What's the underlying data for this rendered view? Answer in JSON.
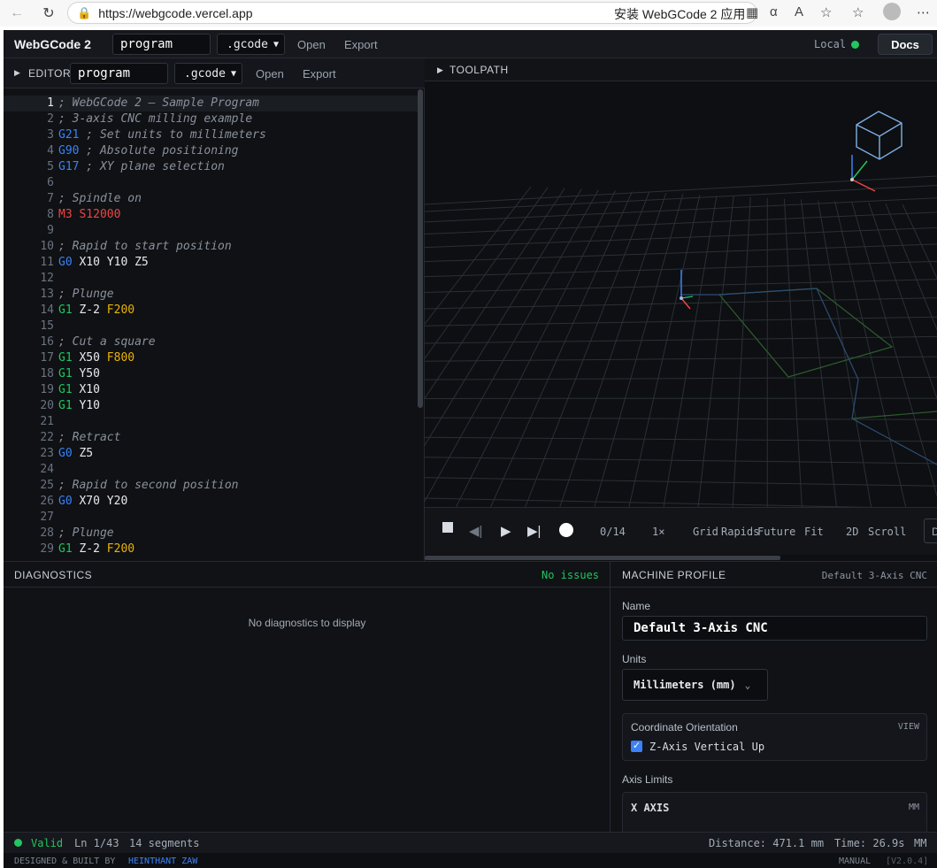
{
  "browser": {
    "url": "https://webgcode.vercel.app",
    "install_text": "安装 WebGCode 2 应用"
  },
  "topbar": {
    "brand": "WebGCode 2",
    "program_name": "program",
    "extension": ".gcode",
    "open_label": "Open",
    "export_label": "Export",
    "local_label": "Local",
    "docs_label": "Docs"
  },
  "editor": {
    "title": "EDITOR",
    "program_name": "program",
    "extension": ".gcode",
    "open_label": "Open",
    "export_label": "Export",
    "lines": [
      {
        "n": "1",
        "tokens": [
          {
            "t": "; WebGCode 2 — Sample Program",
            "c": "comment"
          }
        ]
      },
      {
        "n": "2",
        "tokens": [
          {
            "t": "; 3-axis CNC milling example",
            "c": "comment"
          }
        ]
      },
      {
        "n": "3",
        "tokens": [
          {
            "t": "G21",
            "c": "gset"
          },
          {
            "t": " ; Set units to millimeters",
            "c": "comment"
          }
        ]
      },
      {
        "n": "4",
        "tokens": [
          {
            "t": "G90",
            "c": "gset"
          },
          {
            "t": " ; Absolute positioning",
            "c": "comment"
          }
        ]
      },
      {
        "n": "5",
        "tokens": [
          {
            "t": "G17",
            "c": "gset"
          },
          {
            "t": " ; XY plane selection",
            "c": "comment"
          }
        ]
      },
      {
        "n": "6",
        "tokens": []
      },
      {
        "n": "7",
        "tokens": [
          {
            "t": "; Spindle on",
            "c": "comment"
          }
        ]
      },
      {
        "n": "8",
        "tokens": [
          {
            "t": "M3",
            "c": "m"
          },
          {
            "t": " ",
            "c": "coord"
          },
          {
            "t": "S12000",
            "c": "s"
          }
        ]
      },
      {
        "n": "9",
        "tokens": []
      },
      {
        "n": "10",
        "tokens": [
          {
            "t": "; Rapid to start position",
            "c": "comment"
          }
        ]
      },
      {
        "n": "11",
        "tokens": [
          {
            "t": "G0",
            "c": "gset"
          },
          {
            "t": " X10 Y10 Z5",
            "c": "coord"
          }
        ]
      },
      {
        "n": "12",
        "tokens": []
      },
      {
        "n": "13",
        "tokens": [
          {
            "t": "; Plunge",
            "c": "comment"
          }
        ]
      },
      {
        "n": "14",
        "tokens": [
          {
            "t": "G1",
            "c": "gmove"
          },
          {
            "t": " Z-2 ",
            "c": "coord"
          },
          {
            "t": "F200",
            "c": "f"
          }
        ]
      },
      {
        "n": "15",
        "tokens": []
      },
      {
        "n": "16",
        "tokens": [
          {
            "t": "; Cut a square",
            "c": "comment"
          }
        ]
      },
      {
        "n": "17",
        "tokens": [
          {
            "t": "G1",
            "c": "gmove"
          },
          {
            "t": " X50 ",
            "c": "coord"
          },
          {
            "t": "F800",
            "c": "f"
          }
        ]
      },
      {
        "n": "18",
        "tokens": [
          {
            "t": "G1",
            "c": "gmove"
          },
          {
            "t": " Y50",
            "c": "coord"
          }
        ]
      },
      {
        "n": "19",
        "tokens": [
          {
            "t": "G1",
            "c": "gmove"
          },
          {
            "t": " X10",
            "c": "coord"
          }
        ]
      },
      {
        "n": "20",
        "tokens": [
          {
            "t": "G1",
            "c": "gmove"
          },
          {
            "t": " Y10",
            "c": "coord"
          }
        ]
      },
      {
        "n": "21",
        "tokens": []
      },
      {
        "n": "22",
        "tokens": [
          {
            "t": "; Retract",
            "c": "comment"
          }
        ]
      },
      {
        "n": "23",
        "tokens": [
          {
            "t": "G0",
            "c": "gset"
          },
          {
            "t": " Z5",
            "c": "coord"
          }
        ]
      },
      {
        "n": "24",
        "tokens": []
      },
      {
        "n": "25",
        "tokens": [
          {
            "t": "; Rapid to second position",
            "c": "comment"
          }
        ]
      },
      {
        "n": "26",
        "tokens": [
          {
            "t": "G0",
            "c": "gset"
          },
          {
            "t": " X70 Y20",
            "c": "coord"
          }
        ]
      },
      {
        "n": "27",
        "tokens": []
      },
      {
        "n": "28",
        "tokens": [
          {
            "t": "; Plunge",
            "c": "comment"
          }
        ]
      },
      {
        "n": "29",
        "tokens": [
          {
            "t": "G1",
            "c": "gmove"
          },
          {
            "t": " Z-2 ",
            "c": "coord"
          },
          {
            "t": "F200",
            "c": "f"
          }
        ]
      }
    ]
  },
  "toolpath": {
    "title": "TOOLPATH",
    "progress": "0/14",
    "speed": "1×",
    "grid_label": "Grid",
    "rapids_label": "Rapids",
    "future_label": "Future",
    "fit_label": "Fit",
    "view_2d_label": "2D",
    "scroll_label": "Scroll",
    "extra_label": "D"
  },
  "diagnostics": {
    "title": "DIAGNOSTICS",
    "status": "No issues",
    "empty_text": "No diagnostics to display"
  },
  "machine": {
    "title": "MACHINE PROFILE",
    "profile_name": "Default 3-Axis CNC",
    "name_label": "Name",
    "name_value": "Default 3-Axis CNC",
    "units_label": "Units",
    "units_value": "Millimeters (mm)",
    "orientation_title": "Coordinate Orientation",
    "orientation_view": "VIEW",
    "orientation_option": "Z-Axis Vertical Up",
    "axis_limits_label": "Axis Limits",
    "x_axis_label": "X AXIS",
    "x_axis_unit": "MM"
  },
  "status": {
    "valid": "Valid",
    "line": "Ln 1/43",
    "segments": "14 segments",
    "distance": "Distance: 471.1 mm",
    "time": "Time: 26.9s",
    "unit": "MM"
  },
  "footer": {
    "credit": "DESIGNED & BUILT BY",
    "author": "HEINTHANT ZAW",
    "manual": "MANUAL",
    "version": "[V2.0.4]"
  },
  "colors": {
    "comment": "#8a919c",
    "gmove": "#22c55e",
    "gset": "#3b82f6",
    "m": "#ef4444",
    "s": "#ef4444",
    "f": "#eab308",
    "coord": "#e6e9ee",
    "valid": "#22c55e"
  }
}
